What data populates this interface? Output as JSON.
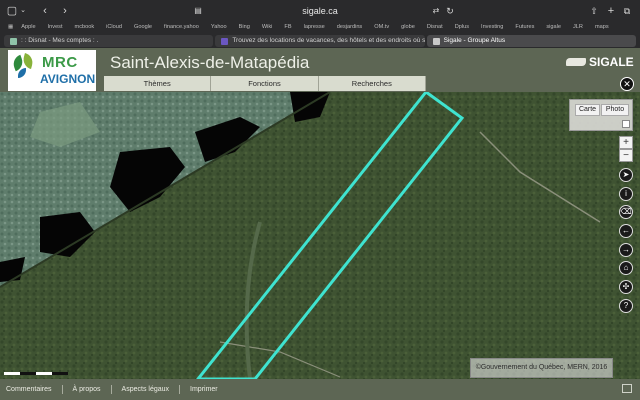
{
  "browser": {
    "url": "sigale.ca",
    "bookmarks": [
      "Apple",
      "Invest",
      "mcbook",
      "iCloud",
      "Google",
      "finance.yahoo",
      "Yahoo",
      "Bing",
      "Wiki",
      "FB",
      "lapresse",
      "desjardins",
      "OM.tv",
      "globe",
      "Disnat",
      "Dplus",
      "Investing",
      "Futures",
      "sigale",
      "JLR",
      "maps"
    ],
    "tabs": [
      {
        "label": ": : Disnat - Mes comptes : ."
      },
      {
        "label": "Trouvez des locations de vacances, des hôtels et des endroits où s..."
      },
      {
        "label": "Sigale - Groupe Altus"
      }
    ]
  },
  "header": {
    "logo_top": "MRC",
    "logo_bottom": "AVIGNON",
    "title": "Saint-Alexis-de-Matapédia",
    "brand": "SIGALE"
  },
  "menu": {
    "items": [
      "Thèmes",
      "Fonctions",
      "Recherches"
    ]
  },
  "basemap": {
    "carte": "Carte",
    "photo": "Photo"
  },
  "map_controls": {
    "zoom_in": "+",
    "zoom_out": "−",
    "close": "✕"
  },
  "attribution": "©Gouvernement du Québec, MERN, 2016",
  "footer": {
    "links": [
      "Commentaires",
      "À propos",
      "Aspects légaux",
      "Imprimer"
    ]
  },
  "colors": {
    "header_green": "#5d6654",
    "parcel_outline": "#3fe3d0",
    "menu_bg": "#d9dccf"
  }
}
